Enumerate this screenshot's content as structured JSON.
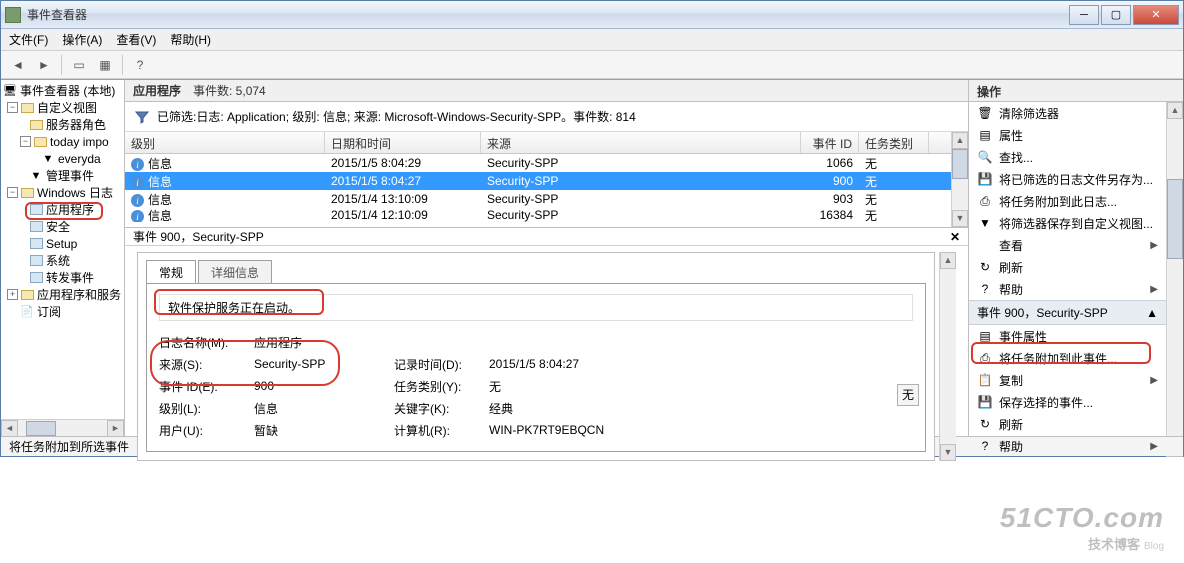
{
  "window": {
    "title": "事件查看器"
  },
  "menu": {
    "file": "文件(F)",
    "operation": "操作(A)",
    "view": "查看(V)",
    "help": "帮助(H)"
  },
  "tree": {
    "root": "事件查看器 (本地)",
    "custom_views": "自定义视图",
    "server_roles": "服务器角色",
    "today_impo": "today impo",
    "everyday": "everyda",
    "admin_events": "管理事件",
    "windows_logs": "Windows 日志",
    "application": "应用程序",
    "security": "安全",
    "setup": "Setup",
    "system": "系统",
    "forwarded": "转发事件",
    "apps_services": "应用程序和服务",
    "subscriptions": "订阅"
  },
  "mid_header": {
    "title": "应用程序",
    "count": "事件数: 5,074"
  },
  "filter_text": "已筛选:日志: Application; 级别: 信息; 来源: Microsoft-Windows-Security-SPP。事件数: 814",
  "columns": {
    "level": "级别",
    "datetime": "日期和时间",
    "source": "来源",
    "eventid": "事件 ID",
    "category": "任务类别"
  },
  "rows": [
    {
      "level": "信息",
      "dt": "2015/1/5 8:04:29",
      "src": "Security-SPP",
      "id": "1066",
      "cat": "无"
    },
    {
      "level": "信息",
      "dt": "2015/1/5 8:04:27",
      "src": "Security-SPP",
      "id": "900",
      "cat": "无"
    },
    {
      "level": "信息",
      "dt": "2015/1/4 13:10:09",
      "src": "Security-SPP",
      "id": "903",
      "cat": "无"
    },
    {
      "level": "信息",
      "dt": "2015/1/4 12:10:09",
      "src": "Security-SPP",
      "id": "16384",
      "cat": "无"
    }
  ],
  "details": {
    "title": "事件 900，Security-SPP",
    "tab_general": "常规",
    "tab_details": "详细信息",
    "message": "软件保护服务正在启动。",
    "fields": {
      "logname_l": "日志名称(M):",
      "logname_v": "应用程序",
      "source_l": "来源(S):",
      "source_v": "Security-SPP",
      "eventid_l": "事件 ID(E):",
      "eventid_v": "900",
      "level_l": "级别(L):",
      "level_v": "信息",
      "user_l": "用户(U):",
      "user_v": "暂缺",
      "recorded_l": "记录时间(D):",
      "recorded_v": "2015/1/5 8:04:27",
      "category_l": "任务类别(Y):",
      "category_v": "无",
      "keywords_l": "关键字(K):",
      "keywords_v": "经典",
      "computer_l": "计算机(R):",
      "computer_v": "WIN-PK7RT9EBQCN"
    },
    "up_btn": "无"
  },
  "actions": {
    "header": "操作",
    "clear_filter": "清除筛选器",
    "properties": "属性",
    "find": "查找...",
    "save_filtered": "将已筛选的日志文件另存为...",
    "attach_task_log": "将任务附加到此日志...",
    "save_filter_custom": "将筛选器保存到自定义视图...",
    "view": "查看",
    "refresh": "刷新",
    "help": "帮助",
    "section2": "事件 900，Security-SPP",
    "event_props": "事件属性",
    "attach_task_event": "将任务附加到此事件...",
    "copy": "复制",
    "save_selected": "保存选择的事件...",
    "refresh2": "刷新",
    "help2": "帮助"
  },
  "statusbar": "将任务附加到所选事件",
  "watermark": {
    "big": "51CTO.com",
    "small": "技术博客",
    "tiny": "Blog"
  }
}
